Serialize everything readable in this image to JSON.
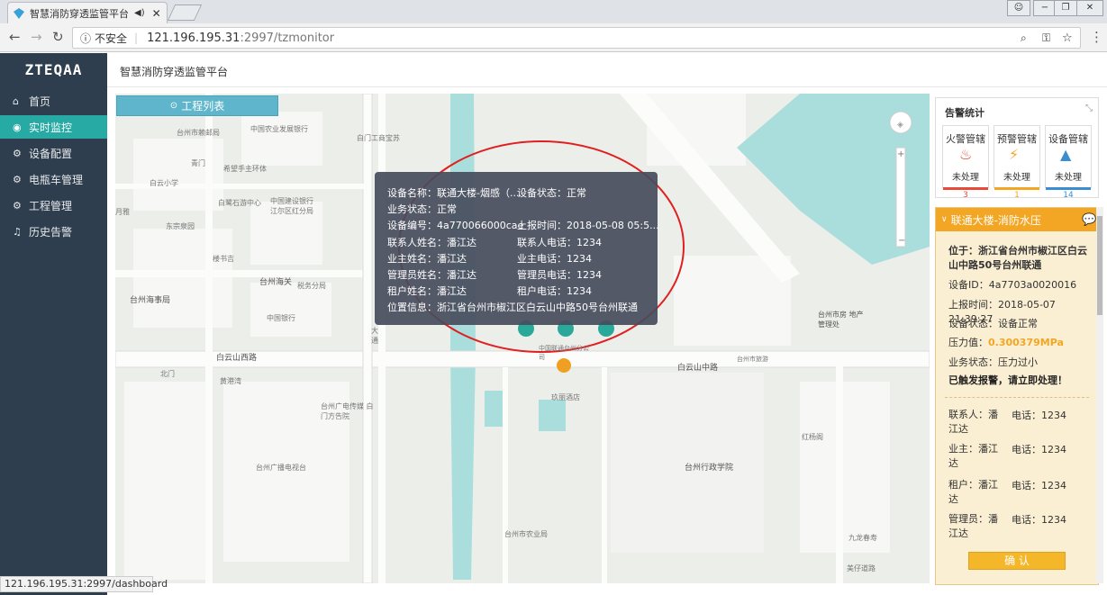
{
  "browser": {
    "tab_title": "智慧消防穿透监管平台",
    "security_label": "不安全",
    "url_host": "121.196.195.31",
    "url_path": ":2997/tzmonitor",
    "status_url": "121.196.195.31:2997/dashboard"
  },
  "app": {
    "logo": "ZTEQAA",
    "title": "智慧消防穿透监管平台"
  },
  "sidebar": {
    "items": [
      {
        "label": "首页",
        "icon": "home-icon"
      },
      {
        "label": "实时监控",
        "icon": "location-icon"
      },
      {
        "label": "设备配置",
        "icon": "gear-icon"
      },
      {
        "label": "电瓶车管理",
        "icon": "gear-icon"
      },
      {
        "label": "工程管理",
        "icon": "gear-icon"
      },
      {
        "label": "历史告警",
        "icon": "bell-icon"
      }
    ]
  },
  "map": {
    "project_list_button": "工程列表",
    "labels": [
      "台州市赖邮局",
      "中国农业发展银行",
      "白门工商宝苏",
      "青门",
      "希望手主环体",
      "白云小学",
      "白鹭石游中心",
      "中国建设银行 江尔区红分局",
      "东宗泉园",
      "月雅",
      "楼书吉",
      "台州海关",
      "税务分局",
      "中国银行",
      "台州海事局",
      "白云山西路",
      "白云山中路",
      "大通",
      "北门",
      "中国联通台州分公司",
      "黄港湾",
      "玖丽酒店",
      "台州广电传媒 白门方告院",
      "台州广播电视台",
      "台州市农业局",
      "台州行政学院",
      "台州市房 地产管理处",
      "台州市旅游",
      "红杨阁",
      "九龙春寿",
      "美仔道路"
    ]
  },
  "popup": {
    "device_name": "设备名称：联通大楼-烟感（...",
    "device_status": "设备状态：正常",
    "business_status": "业务状态：正常",
    "device_no": "设备编号：4a770066000cae",
    "report_time": "上报时间：2018-05-08 05:5...",
    "contact_name": "联系人姓名：潘江达",
    "contact_phone": "联系人电话：1234",
    "owner_name": "业主姓名：潘江达",
    "owner_phone": "业主电话：1234",
    "admin_name": "管理员姓名：潘江达",
    "admin_phone": "管理员电话：1234",
    "tenant_name": "租户姓名：潘江达",
    "tenant_phone": "租户电话：1234",
    "location": "位置信息：浙江省台州市椒江区白云山中路50号台州联通"
  },
  "alarm_stats": {
    "title": "告警统计",
    "fire": {
      "label": "火警管辖",
      "status": "未处理",
      "count": "3"
    },
    "warning": {
      "label": "预警管辖",
      "status": "未处理",
      "count": "1"
    },
    "device": {
      "label": "设备管辖",
      "status": "未处理",
      "count": "14"
    }
  },
  "detail": {
    "header": "联通大楼-消防水压",
    "location": "位于：浙江省台州市椒江区白云山中路50号台州联通",
    "device_id": "设备ID：4a7703a0020016",
    "report_time": "上报时间：2018-05-07 21:39:27",
    "device_status": "设备状态：设备正常",
    "pressure_label": "压力值：",
    "pressure_value": "0.300379MPa",
    "business_status": "业务状态：压力过小",
    "alert_text": "已触发报警，请立即处理！",
    "contact": {
      "label": "联系人：潘江达",
      "phone": "电话：1234"
    },
    "owner": {
      "label": "业主：潘江达",
      "phone": "电话：1234"
    },
    "tenant": {
      "label": "租户：潘江达",
      "phone": "电话：1234"
    },
    "admin": {
      "label": "管理员：潘江达",
      "phone": "电话：1234"
    },
    "confirm": "确 认"
  },
  "colors": {
    "sidebar": "#2e3e4e",
    "active": "#27a9a4",
    "accent": "#f2a623",
    "annotation": "#e02020"
  }
}
